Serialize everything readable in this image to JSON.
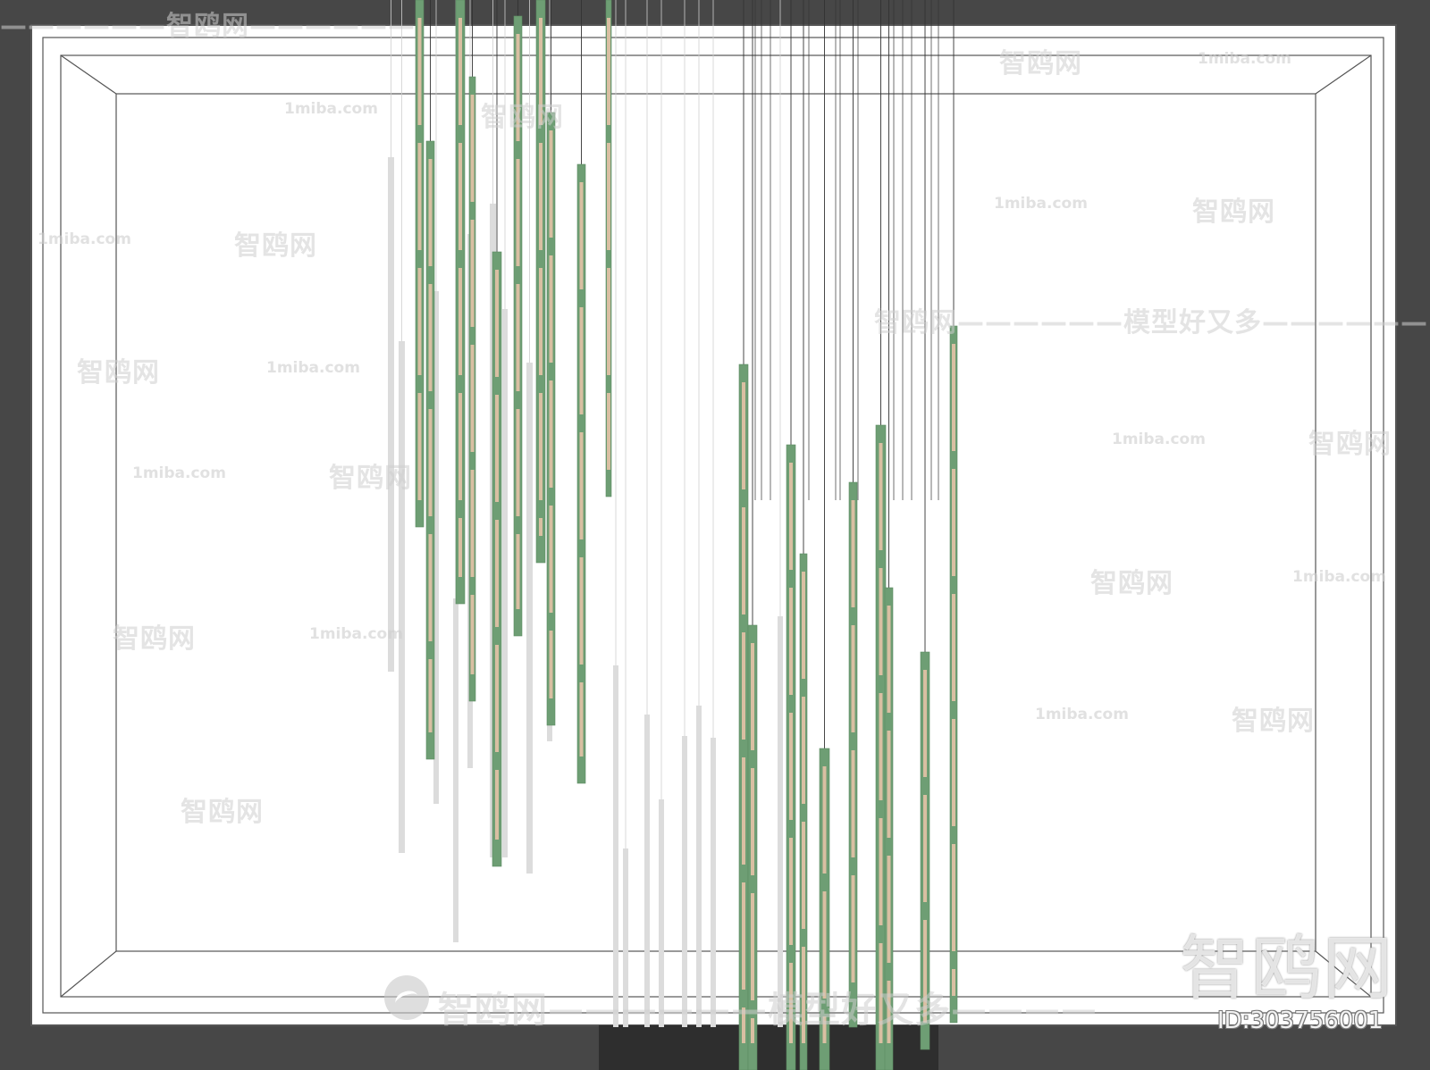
{
  "scene": {
    "colors": {
      "background": "#474747",
      "wall": "#ffffff",
      "outline": "#555555",
      "tube_green": "#6e9e74",
      "tube_light": "#d9bfa2",
      "tube_ghost": "#dcdcdc",
      "wire": "#333333"
    }
  },
  "watermarks": {
    "site": "1miba.com",
    "brand": "智鸥网",
    "dashes": "——————",
    "brand_slogan": "智鸥网——————模型好又多——————",
    "bottom_slogan": "智鸥网——————模型好又多————",
    "big_brand": "智鸥网",
    "id_text": "ID:303756001"
  }
}
